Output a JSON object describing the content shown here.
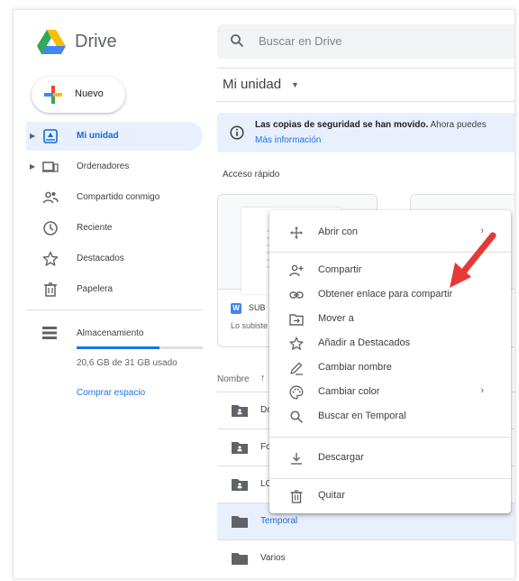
{
  "header": {
    "app_name": "Drive",
    "search_placeholder": "Buscar en Drive"
  },
  "sidebar": {
    "new_label": "Nuevo",
    "items": [
      {
        "label": "Mi unidad",
        "icon": "drive-icon",
        "active": true
      },
      {
        "label": "Ordenadores",
        "icon": "computers-icon"
      },
      {
        "label": "Compartido conmigo",
        "icon": "shared-people-icon"
      },
      {
        "label": "Reciente",
        "icon": "clock-icon"
      },
      {
        "label": "Destacados",
        "icon": "star-icon"
      },
      {
        "label": "Papelera",
        "icon": "trash-icon"
      }
    ],
    "storage_label": "Almacenamiento",
    "storage_used": "20,6 GB de 31 GB usado",
    "storage_fraction": 0.66,
    "buy_label": "Comprar espacio"
  },
  "main": {
    "breadcrumb": "Mi unidad",
    "banner": {
      "bold_text": "Las copias de seguridad se han movido.",
      "text": " Ahora puedes",
      "link": "Más información"
    },
    "quick_access_label": "Acceso rápido",
    "cards": [
      {
        "name": "SUB",
        "sub": "Lo subiste"
      }
    ],
    "list_header": "Nombre",
    "list_arrow": "↑",
    "rows": [
      {
        "name": "Do",
        "shared": true
      },
      {
        "name": "Fo",
        "shared": true
      },
      {
        "name": "LC",
        "shared": true
      },
      {
        "name": "Temporal",
        "selected": true
      },
      {
        "name": "Varios"
      }
    ]
  },
  "context_menu": {
    "items": [
      {
        "label": "Abrir con",
        "icon": "move-arrows-icon",
        "submenu": "›"
      },
      {
        "label": "Compartir",
        "icon": "add-person-icon"
      },
      {
        "label": "Obtener enlace para compartir",
        "icon": "link-icon"
      },
      {
        "label": "Mover a",
        "icon": "move-to-folder-icon"
      },
      {
        "label": "Añadir a Destacados",
        "icon": "star-icon"
      },
      {
        "label": "Cambiar nombre",
        "icon": "pencil-icon"
      },
      {
        "label": "Cambiar color",
        "icon": "palette-icon",
        "submenu": "›"
      },
      {
        "label": "Buscar en Temporal",
        "icon": "search-icon"
      },
      {
        "label": "Descargar",
        "icon": "download-icon"
      },
      {
        "label": "Quitar",
        "icon": "trash-icon"
      }
    ]
  },
  "colors": {
    "accent": "#1a73e8",
    "active_bg": "#e8f0fe",
    "annotation_arrow": "#e53935"
  }
}
